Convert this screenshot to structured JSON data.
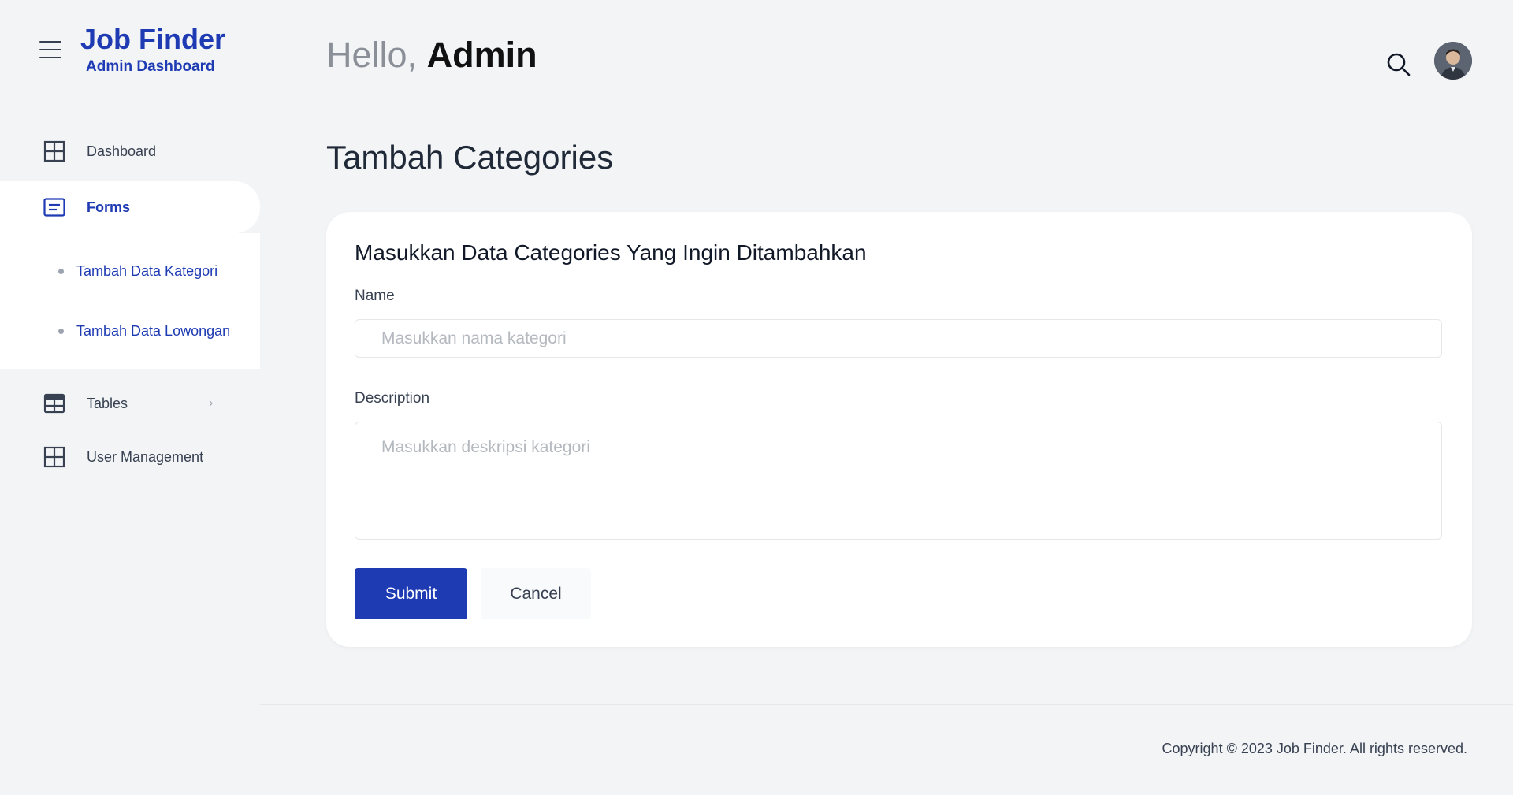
{
  "brand": {
    "title": "Job Finder",
    "subtitle": "Admin Dashboard"
  },
  "sidebar": {
    "items": [
      {
        "label": "Dashboard",
        "icon": "grid-icon"
      },
      {
        "label": "Forms",
        "icon": "form-icon",
        "active": true,
        "children": [
          {
            "label": "Tambah Data Kategori"
          },
          {
            "label": "Tambah Data Lowongan"
          }
        ]
      },
      {
        "label": "Tables",
        "icon": "table-icon",
        "chevron": "›"
      },
      {
        "label": "User Management",
        "icon": "grid-icon"
      }
    ]
  },
  "header": {
    "hello": "Hello,",
    "name": "Admin"
  },
  "page": {
    "title": "Tambah Categories"
  },
  "form": {
    "title": "Masukkan Data Categories Yang Ingin Ditambahkan",
    "name_label": "Name",
    "name_placeholder": "Masukkan nama kategori",
    "description_label": "Description",
    "description_placeholder": "Masukkan deskripsi kategori",
    "submit_label": "Submit",
    "cancel_label": "Cancel"
  },
  "footer": {
    "copyright": "Copyright © 2023 Job Finder. All rights reserved."
  },
  "colors": {
    "accent": "#1e3bb3",
    "background": "#f3f4f6",
    "card": "#ffffff"
  }
}
